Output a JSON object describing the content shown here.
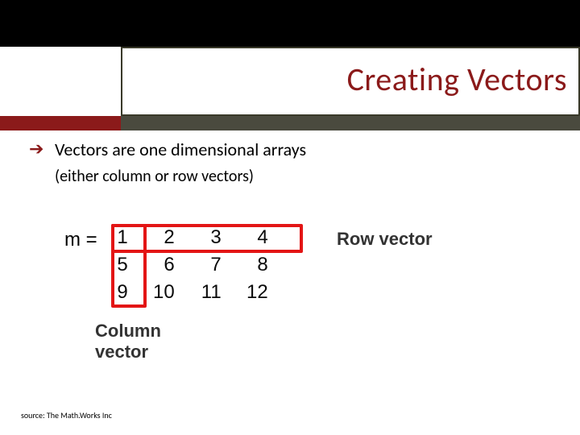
{
  "title": "Creating Vectors",
  "bullet": "Vectors are one dimensional arrays",
  "subbullet": "(either column or row vectors)",
  "matrix": {
    "label": "m =",
    "rows": [
      [
        "1",
        "2",
        "3",
        "4"
      ],
      [
        "5",
        "6",
        "7",
        "8"
      ],
      [
        "9",
        "10",
        "11",
        "12"
      ]
    ]
  },
  "labels": {
    "row_vector": "Row vector",
    "column_vector_l1": "Column",
    "column_vector_l2": "vector"
  },
  "source": "source: The Math.Works Inc"
}
